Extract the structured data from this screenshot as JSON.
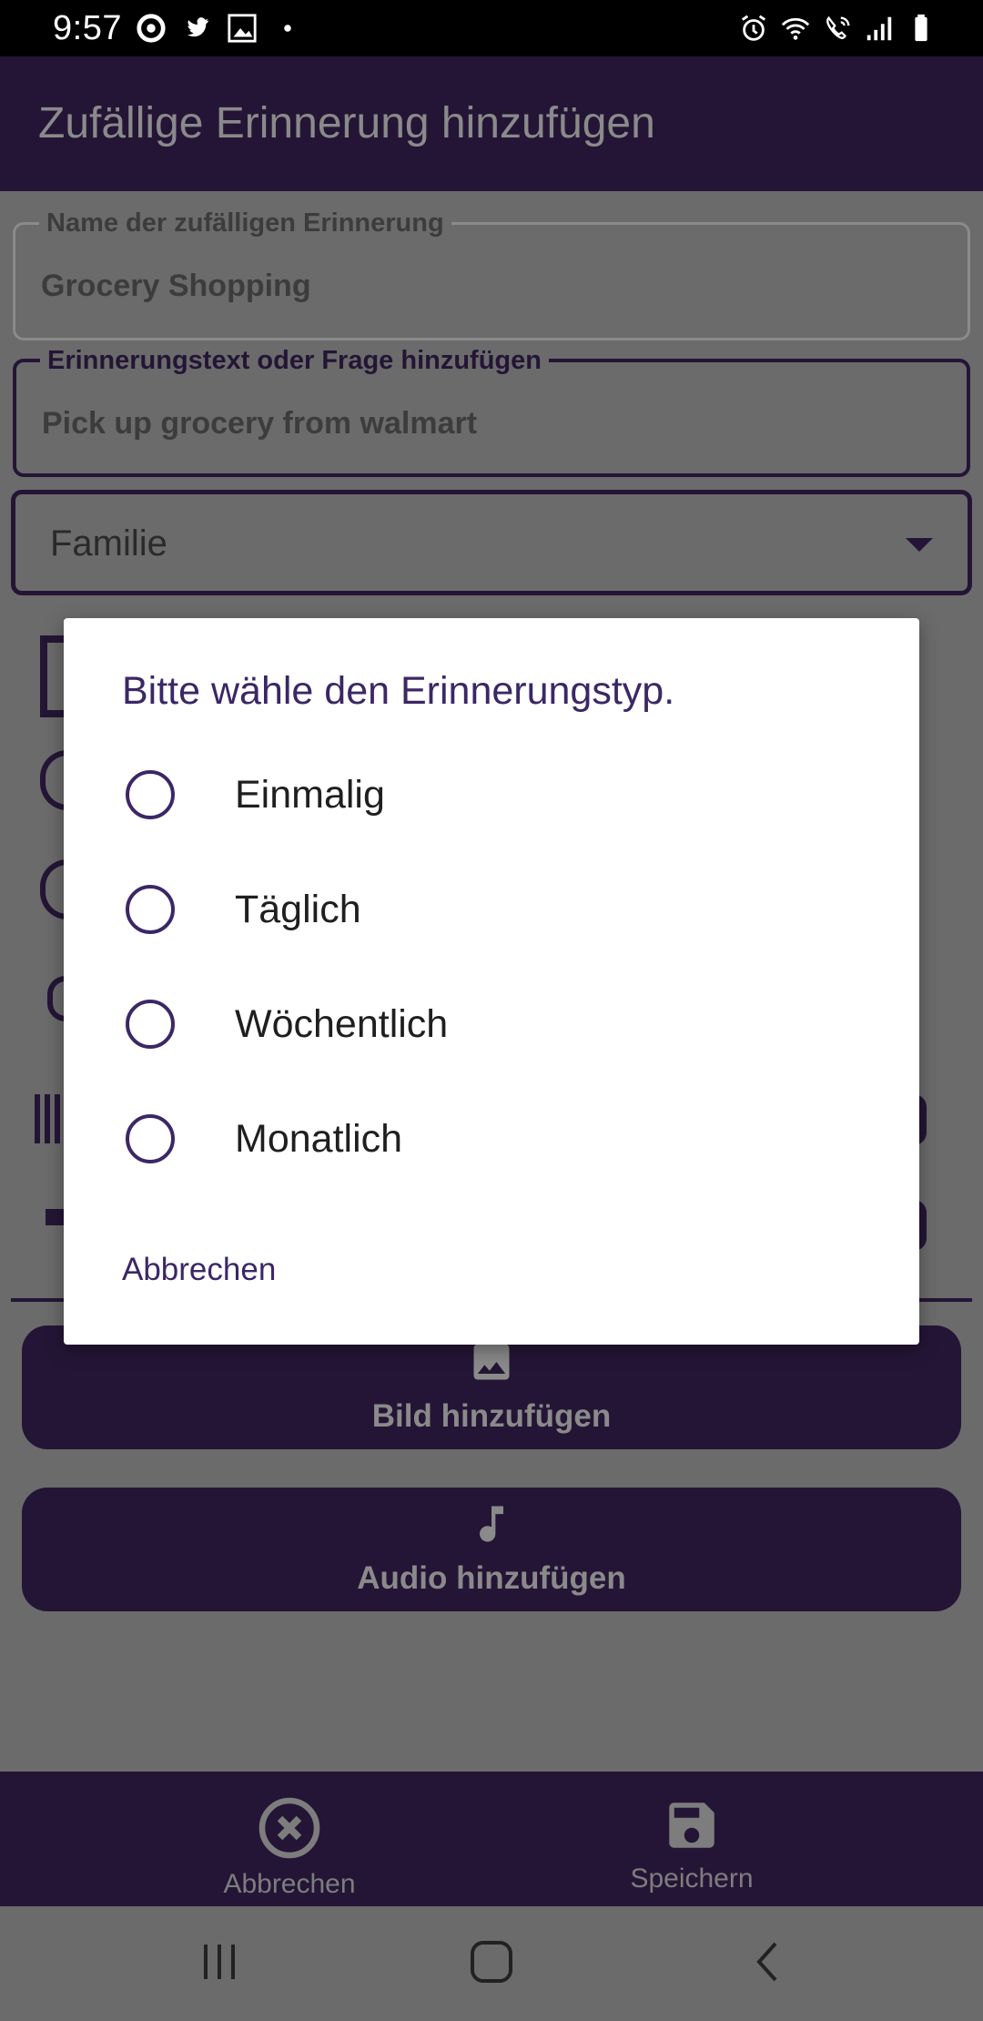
{
  "status_bar": {
    "time": "9:57",
    "left_icons": [
      "notification-ring-icon",
      "twitter-icon",
      "photo-app-icon",
      "dot-icon"
    ],
    "right_icons": [
      "alarm-icon",
      "wifi-icon",
      "wifi-call-icon",
      "signal-icon",
      "battery-icon"
    ]
  },
  "app_bar": {
    "title": "Zufällige Erinnerung hinzufügen"
  },
  "form": {
    "name_label": "Name der zufälligen Erinnerung",
    "name_value": "Grocery Shopping",
    "text_label": "Erinnerungstext oder Frage hinzufügen",
    "text_value": "Pick up grocery from walmart",
    "category_value": "Familie"
  },
  "buttons": {
    "add_image": "Bild hinzufügen",
    "add_audio": "Audio hinzufügen"
  },
  "bottom_bar": {
    "cancel": "Abbrechen",
    "save": "Speichern"
  },
  "dialog": {
    "title": "Bitte wähle den Erinnerungstyp.",
    "options": [
      {
        "label": "Einmalig",
        "selected": false
      },
      {
        "label": "Täglich",
        "selected": false
      },
      {
        "label": "Wöchentlich",
        "selected": false
      },
      {
        "label": "Monatlich",
        "selected": false
      }
    ],
    "cancel": "Abbrechen"
  },
  "colors": {
    "primary_dark": "#241536",
    "dialog_accent": "#3b2766",
    "scrim": "#6b6b6b"
  }
}
